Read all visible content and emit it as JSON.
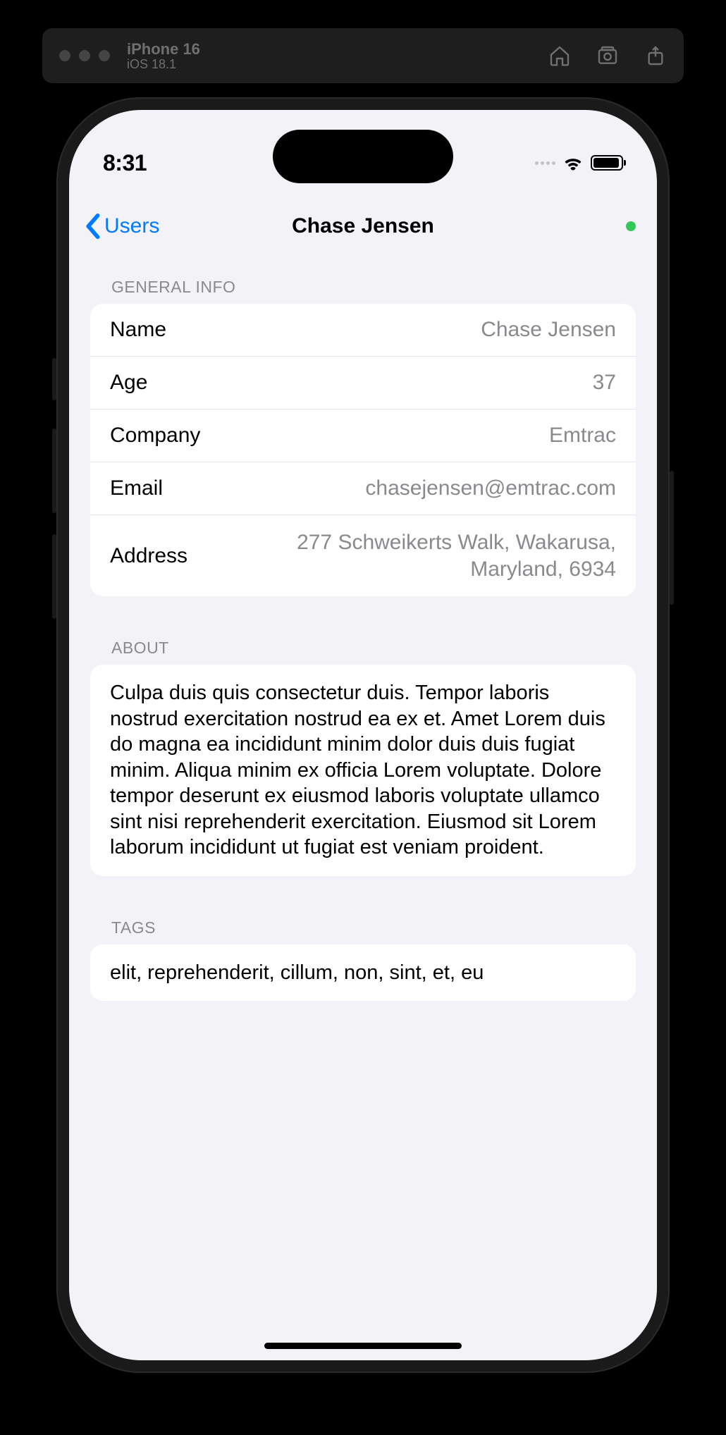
{
  "simulator": {
    "device": "iPhone 16",
    "os": "iOS 18.1"
  },
  "status": {
    "time": "8:31"
  },
  "nav": {
    "back_label": "Users",
    "title": "Chase Jensen"
  },
  "sections": {
    "general": {
      "header": "General Info",
      "rows": {
        "name": {
          "label": "Name",
          "value": "Chase Jensen"
        },
        "age": {
          "label": "Age",
          "value": "37"
        },
        "company": {
          "label": "Company",
          "value": "Emtrac"
        },
        "email": {
          "label": "Email",
          "value": "chasejensen@emtrac.com"
        },
        "address": {
          "label": "Address",
          "value": "277 Schweikerts Walk, Wakarusa, Maryland, 6934"
        }
      }
    },
    "about": {
      "header": "About",
      "text": "Culpa duis quis consectetur duis. Tempor laboris nostrud exercitation nostrud ea ex et. Amet Lorem duis do magna ea incididunt minim dolor duis duis fugiat minim. Aliqua minim ex officia Lorem voluptate. Dolore tempor deserunt ex eiusmod laboris voluptate ullamco sint nisi reprehenderit exercitation. Eiusmod sit Lorem laborum incididunt ut fugiat est veniam proident."
    },
    "tags": {
      "header": "Tags",
      "text": "elit, reprehenderit, cillum, non, sint, et, eu"
    }
  }
}
